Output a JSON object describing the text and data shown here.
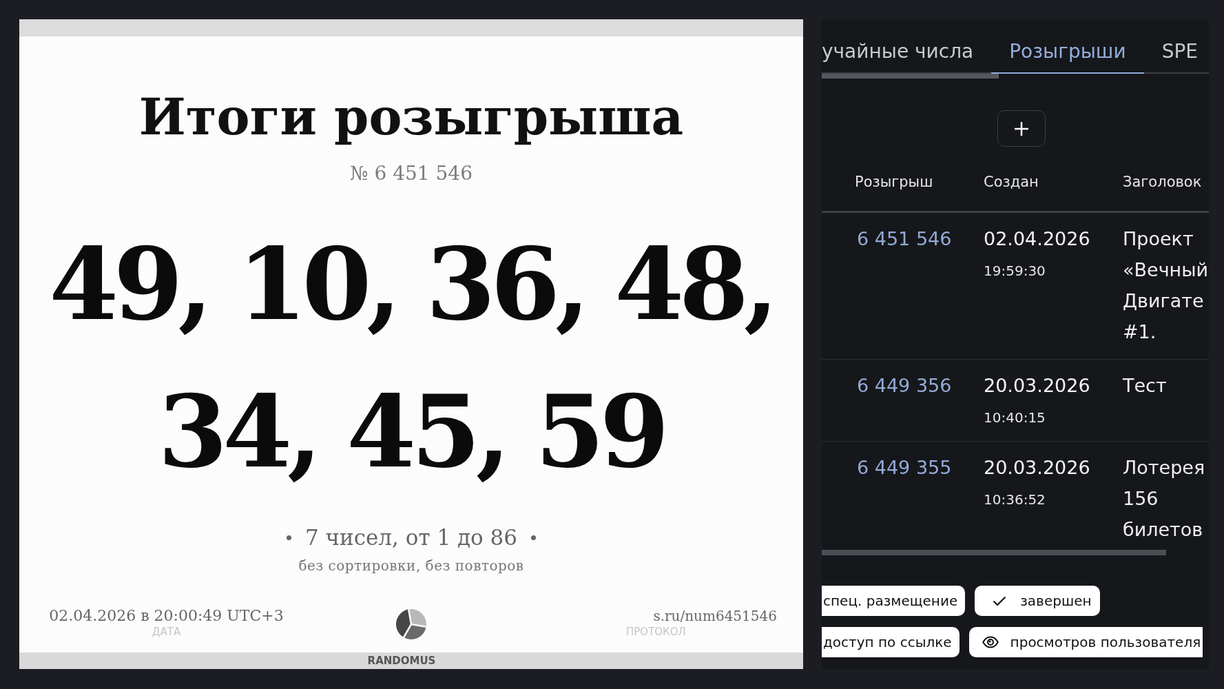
{
  "result_card": {
    "title": "Итоги розыгрыша",
    "draw_number": "№ 6 451 546",
    "numbers": "49, 10, 36, 48, 34, 45, 59",
    "summary": "7 чисел, от 1 до 86",
    "options": "без сортировки, без повторов",
    "date": {
      "value": "02.04.2026 в 20:00:49 UTC+3",
      "label": "ДАТА"
    },
    "brand": "RANDOMUS",
    "protocol": {
      "value": "s.ru/num6451546",
      "label": "ПРОТОКОЛ"
    }
  },
  "draws_panel": {
    "tabs": [
      {
        "label": "учайные числа",
        "selected": false
      },
      {
        "label": "Розыгрыши",
        "selected": true
      },
      {
        "label": "SPE",
        "selected": false
      }
    ],
    "table": {
      "columns": [
        "Розыгрыш",
        "Создан",
        "Заголовок"
      ],
      "rows": [
        {
          "draw": "6 451 546",
          "date": "02.04.2026",
          "time": "19:59:30",
          "title": "Проект «Вечный Двигате #1."
        },
        {
          "draw": "6 449 356",
          "date": "20.03.2026",
          "time": "10:40:15",
          "title": "Тест"
        },
        {
          "draw": "6 449 355",
          "date": "20.03.2026",
          "time": "10:36:52",
          "title": "Лотерея 156 билетов"
        }
      ]
    },
    "tags": [
      {
        "kind": "plain",
        "label": "спец. размещение"
      },
      {
        "kind": "status",
        "label": "завершен"
      },
      {
        "kind": "plain",
        "label": "доступ по ссылке"
      },
      {
        "kind": "views",
        "label": "просмотров пользователя"
      }
    ]
  }
}
